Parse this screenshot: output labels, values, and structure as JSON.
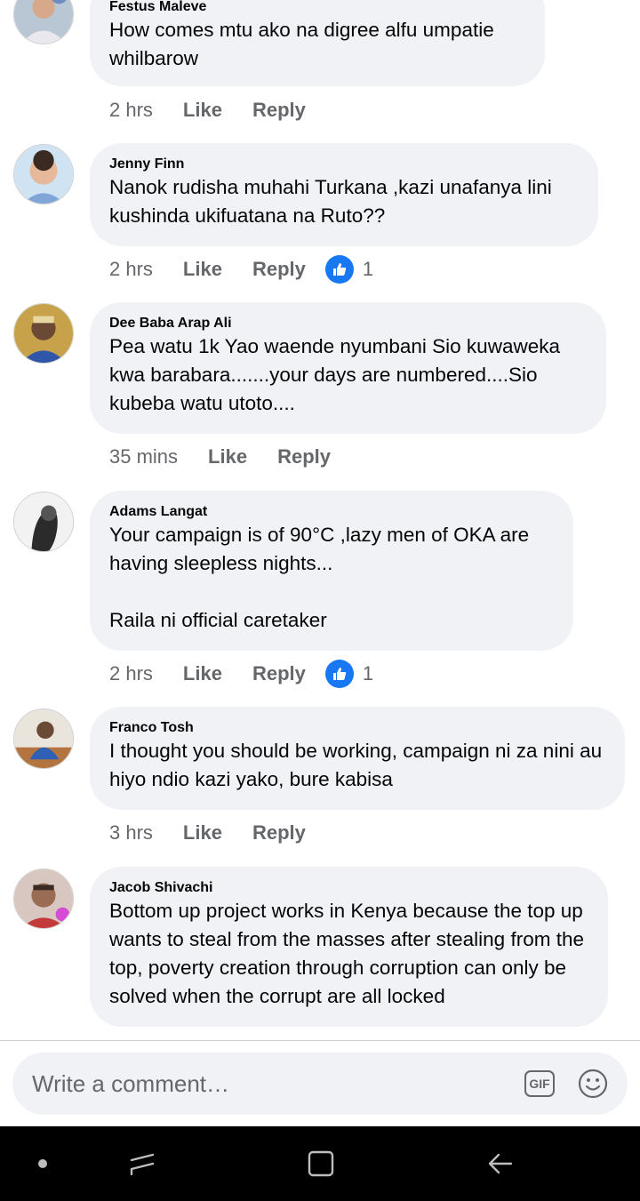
{
  "comments": [
    {
      "author": "Festus Maleve",
      "text": "How comes mtu ako na digree alfu umpatie whilbarow",
      "time": "2 hrs",
      "like_label": "Like",
      "reply_label": "Reply"
    },
    {
      "author": "Jenny Finn",
      "text": "Nanok rudisha muhahi Turkana ,kazi unafanya lini kushinda ukifuatana na Ruto??",
      "time": "2 hrs",
      "like_label": "Like",
      "reply_label": "Reply",
      "reaction_count": "1"
    },
    {
      "author": "Dee Baba Arap Ali",
      "text": "Pea watu 1k Yao waende nyumbani Sio kuwaweka kwa barabara.......your days are numbered....Sio kubeba watu utoto....",
      "time": "35 mins",
      "like_label": "Like",
      "reply_label": "Reply"
    },
    {
      "author": "Adams Langat",
      "text": "Your campaign is of 90°C ,lazy men of OKA are having sleepless nights...\n\nRaila ni official caretaker",
      "time": "2 hrs",
      "like_label": "Like",
      "reply_label": "Reply",
      "reaction_count": "1"
    },
    {
      "author": "Franco Tosh",
      "text": "I thought you should be working, campaign ni za nini au hiyo ndio kazi yako, bure kabisa",
      "time": "3 hrs",
      "like_label": "Like",
      "reply_label": "Reply"
    },
    {
      "author": "Jacob Shivachi",
      "text": "Bottom up project works in Kenya because the top up wants to steal from the masses after stealing from the top, poverty creation through corruption can only be solved when the corrupt are all locked"
    }
  ],
  "composer": {
    "placeholder": "Write a comment…",
    "gif_label": "GIF"
  },
  "icons": {
    "like_reaction": "thumbs-up-icon",
    "gif": "gif-icon",
    "emoji": "smiley-icon",
    "nav": [
      "dot-icon",
      "recent-apps-icon",
      "home-icon",
      "back-icon"
    ]
  },
  "colors": {
    "bubble": "#f0f2f5",
    "meta_text": "#65676b",
    "like_blue": "#1877f2",
    "navbar": "#000000"
  }
}
